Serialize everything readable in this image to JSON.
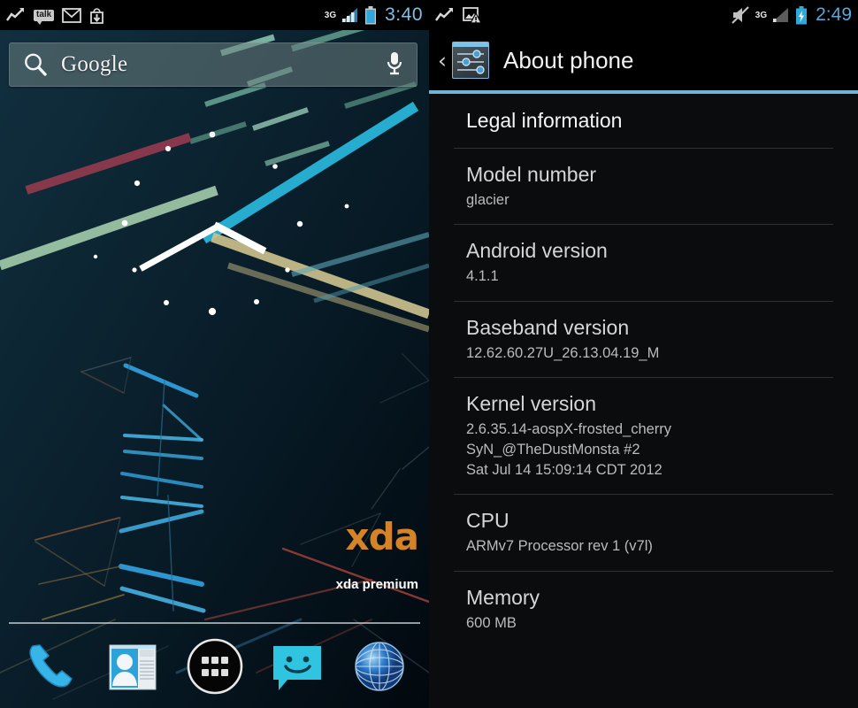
{
  "home": {
    "statusbar": {
      "notifications": [
        {
          "name": "trend-chart-icon",
          "label": "activity"
        },
        {
          "name": "talk-icon",
          "label": "talk"
        },
        {
          "name": "gmail-icon",
          "label": "M"
        },
        {
          "name": "download-icon",
          "label": "download"
        }
      ],
      "network_label": "3G",
      "signal": "signal-icon",
      "battery": "battery-icon",
      "time": "3:40"
    },
    "search": {
      "placeholder": "Google",
      "search_icon": "search-icon",
      "voice_icon": "microphone-icon"
    },
    "watermark": {
      "logo": "xda",
      "caption": "xda premium"
    },
    "dock": [
      {
        "name": "dock-phone",
        "label": "Phone"
      },
      {
        "name": "dock-people",
        "label": "People"
      },
      {
        "name": "dock-app-drawer",
        "label": "Apps"
      },
      {
        "name": "dock-messaging",
        "label": "Messaging"
      },
      {
        "name": "dock-browser",
        "label": "Browser"
      }
    ],
    "colors": {
      "accent_blue": "#7ec0e8",
      "xda_orange": "#e08a28"
    }
  },
  "about": {
    "statusbar": {
      "notifications": [
        {
          "name": "trend-chart-icon",
          "label": "activity"
        },
        {
          "name": "image-warning-icon",
          "label": "image error"
        }
      ],
      "mute_icon": "mute-icon",
      "network_label": "3G",
      "battery": "battery-charging-icon",
      "time": "2:49"
    },
    "header": {
      "back_label": "‹",
      "icon": "settings-sliders-icon",
      "title": "About phone"
    },
    "accent_color": "#6fb4d8",
    "items": [
      {
        "name": "legal-information",
        "title": "Legal information",
        "lines": []
      },
      {
        "name": "model-number",
        "title": "Model number",
        "lines": [
          "glacier"
        ]
      },
      {
        "name": "android-version",
        "title": "Android version",
        "lines": [
          "4.1.1"
        ]
      },
      {
        "name": "baseband-version",
        "title": "Baseband version",
        "lines": [
          "12.62.60.27U_26.13.04.19_M"
        ]
      },
      {
        "name": "kernel-version",
        "title": "Kernel version",
        "lines": [
          "2.6.35.14-aospX-frosted_cherry",
          "SyN_@TheDustMonsta #2",
          "Sat Jul 14 15:09:14 CDT 2012"
        ]
      },
      {
        "name": "cpu",
        "title": "CPU",
        "lines": [
          "ARMv7 Processor rev 1 (v7l)"
        ]
      },
      {
        "name": "memory",
        "title": "Memory",
        "lines": [
          "600 MB"
        ]
      }
    ]
  }
}
